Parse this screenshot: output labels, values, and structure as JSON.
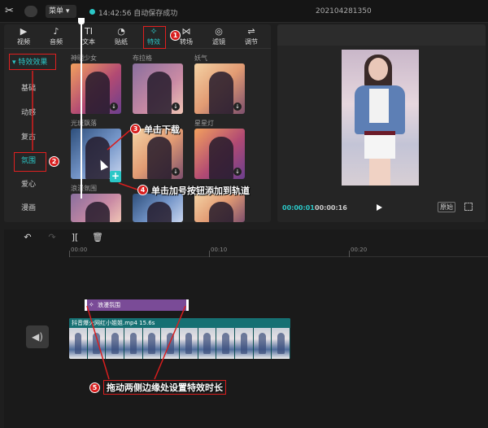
{
  "app": {
    "menu_label": "菜单 ▾",
    "save_status": "14:42:56 自动保存成功",
    "project_name": "202104281350"
  },
  "toolbar": {
    "tabs": [
      {
        "label": "视频",
        "icon": "video-icon",
        "glyph": "▶"
      },
      {
        "label": "音频",
        "icon": "audio-icon",
        "glyph": "♪"
      },
      {
        "label": "文本",
        "icon": "text-icon",
        "glyph": "TI"
      },
      {
        "label": "贴纸",
        "icon": "sticker-icon",
        "glyph": "◔"
      },
      {
        "label": "特效",
        "icon": "effects-icon",
        "glyph": "✧",
        "active": true
      },
      {
        "label": "转场",
        "icon": "transition-icon",
        "glyph": "⋈"
      },
      {
        "label": "滤镜",
        "icon": "filter-icon",
        "glyph": "◎"
      },
      {
        "label": "调节",
        "icon": "adjust-icon",
        "glyph": "⇌"
      }
    ]
  },
  "categories": {
    "header": "▾ 特效效果",
    "items": [
      "基础",
      "动感",
      "复古",
      "氛围",
      "爱心",
      "漫画"
    ],
    "active_index": 3
  },
  "effects": {
    "row1_labels": [
      "神明少女",
      "布拉格",
      "妖气"
    ],
    "row2_labels": [
      "光斑飘落",
      "",
      "星星灯"
    ],
    "row3_labels": [
      "浪漫氛围",
      "",
      ""
    ],
    "add_glyph": "+",
    "download_glyph": "↓"
  },
  "preview": {
    "current_time": "00:00:01",
    "total_time": "00:00:16",
    "ratio_label": "原始"
  },
  "timeline": {
    "toolbar_glyphs": [
      "↶",
      "↷",
      "][",
      "🗑"
    ],
    "ruler_labels": [
      "00:00",
      "00:10",
      "00:20"
    ],
    "effect_clip_label": "浪漫氛围",
    "effect_clip_icon": "✧",
    "video_clip_label": "抖音爆火网红小姐姐.mp4   15.6s",
    "audio_glyph": "◀)"
  },
  "annotations": {
    "steps": [
      "1",
      "2",
      "3",
      "4",
      "5"
    ],
    "step3_text": "单击下载",
    "step4_text": "单击加号按钮添加到轨道",
    "step5_text": "拖动两侧边缘处设置特效时长"
  },
  "colors": {
    "accent": "#2bc7c7",
    "annotation_red": "#d81e1e",
    "effect_clip": "#7a4b97",
    "video_clip": "#1f8a8d"
  }
}
